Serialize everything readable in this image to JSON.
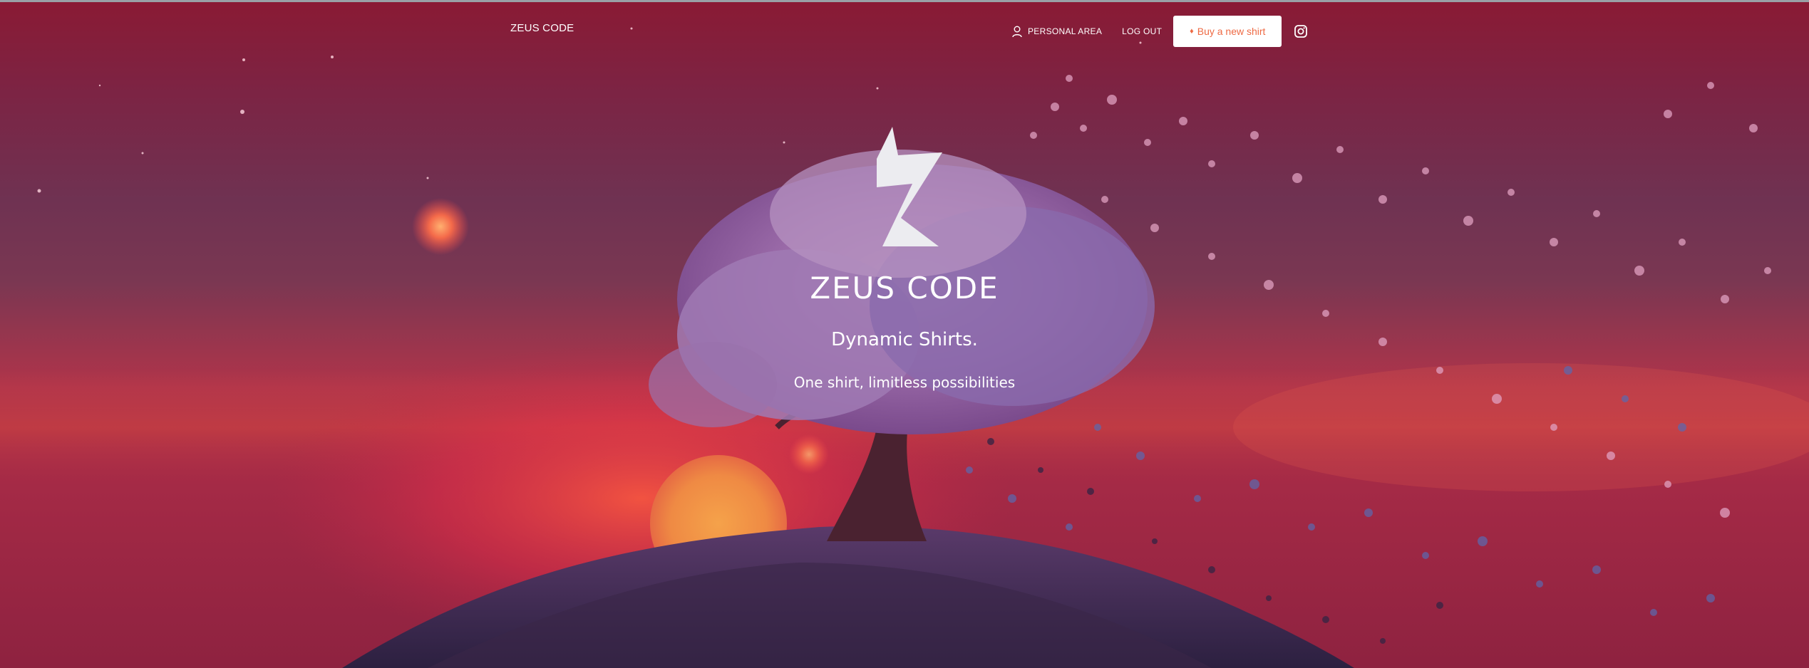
{
  "header": {
    "brand": "ZEUS CODE",
    "nav": {
      "personal_area": "PERSONAL AREA",
      "log_out": "LOG OUT",
      "buy_button": "Buy a new shirt"
    },
    "icons": {
      "user": "user-icon",
      "gem": "gem-icon",
      "instagram": "instagram-icon"
    }
  },
  "hero": {
    "logo": "zeus-z-logo",
    "title": "ZEUS CODE",
    "subtitle": "Dynamic Shirts.",
    "tagline": "One shirt, limitless possibilities"
  },
  "colors": {
    "accent": "#ee6a44",
    "button_bg": "#ffffff",
    "text": "#ffffff"
  }
}
